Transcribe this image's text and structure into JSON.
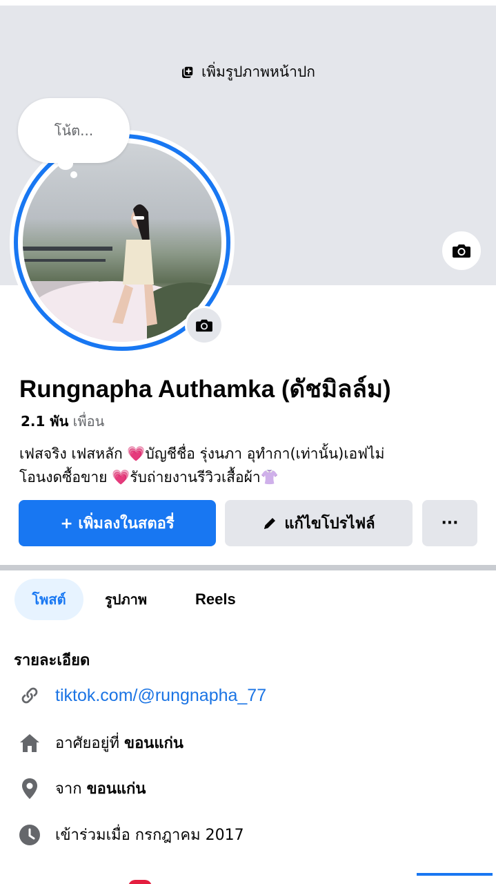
{
  "cover": {
    "add_label": "เพิ่มรูปภาพหน้าปก"
  },
  "note": {
    "placeholder": "โน้ต..."
  },
  "profile": {
    "name": "Rungnapha Authamka (ดัชมิลล์ม)",
    "friends_count": "2.1 พัน",
    "friends_label": "เพื่อน",
    "bio_line1": "เฟสจริง เฟสหลัก 💗บัญชีชื่อ รุ่งนภา อุทำกา(เท่านั้น)เอฟไม่",
    "bio_line2": "โอนงดซื้อขาย 💗รับถ่ายงานรีวิวเสื้อผ้า👚"
  },
  "actions": {
    "add_story": "+ เพิ่มลงในสตอรี่",
    "edit_profile": "แก้ไขโปรไฟล์",
    "more": "···"
  },
  "tabs": [
    {
      "label": "โพสต์"
    },
    {
      "label": "รูปภาพ"
    },
    {
      "label": "Reels"
    }
  ],
  "details": {
    "title": "รายละเอียด",
    "link": "tiktok.com/@rungnapha_77",
    "lives_prefix": "อาศัยอยู่ที่",
    "lives_place": "ขอนแก่น",
    "from_prefix": "จาก",
    "from_place": "ขอนแก่น",
    "joined": "เข้าร่วมเมื่อ กรกฎาคม 2017"
  },
  "colors": {
    "accent": "#1877f2",
    "link": "#1b74e4",
    "button_grey": "#e4e6eb"
  }
}
